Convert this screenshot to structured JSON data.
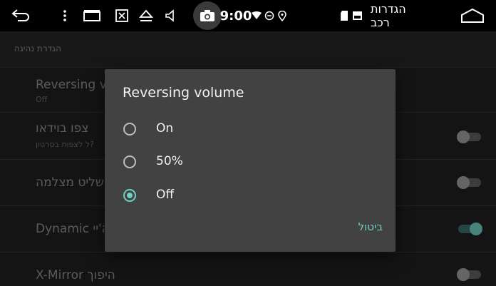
{
  "statusbar": {
    "time": "9:00",
    "title": "הגדרות רכב",
    "accent": "#6fd0c6",
    "icons": [
      "back-icon",
      "more-vert-icon",
      "window-icon",
      "screenshot-icon",
      "eject-icon",
      "volume-icon",
      "camera-icon",
      "wifi-icon",
      "do-not-disturb-icon",
      "location-icon",
      "sd-card-icon",
      "image-icon",
      "home-icon"
    ]
  },
  "section": {
    "label": "הגדרת נהיגה"
  },
  "rows": [
    {
      "title": "Reversing v",
      "subtitle": "Off"
    },
    {
      "title": "צפו בוידאו",
      "subtitle": "ל לצפות בסרטון?",
      "toggle": "off"
    },
    {
      "title": "שליט מצלמה",
      "toggle": "off"
    },
    {
      "title": "Dynamic ה'יי",
      "toggle": "on"
    },
    {
      "title": "X-Mirror היפוך",
      "toggle": "off"
    }
  ],
  "dialog": {
    "title": "Reversing volume",
    "options": [
      {
        "label": "On",
        "checked": false
      },
      {
        "label": "50%",
        "checked": false
      },
      {
        "label": "Off",
        "checked": true
      }
    ],
    "cancel": "ביטול"
  }
}
